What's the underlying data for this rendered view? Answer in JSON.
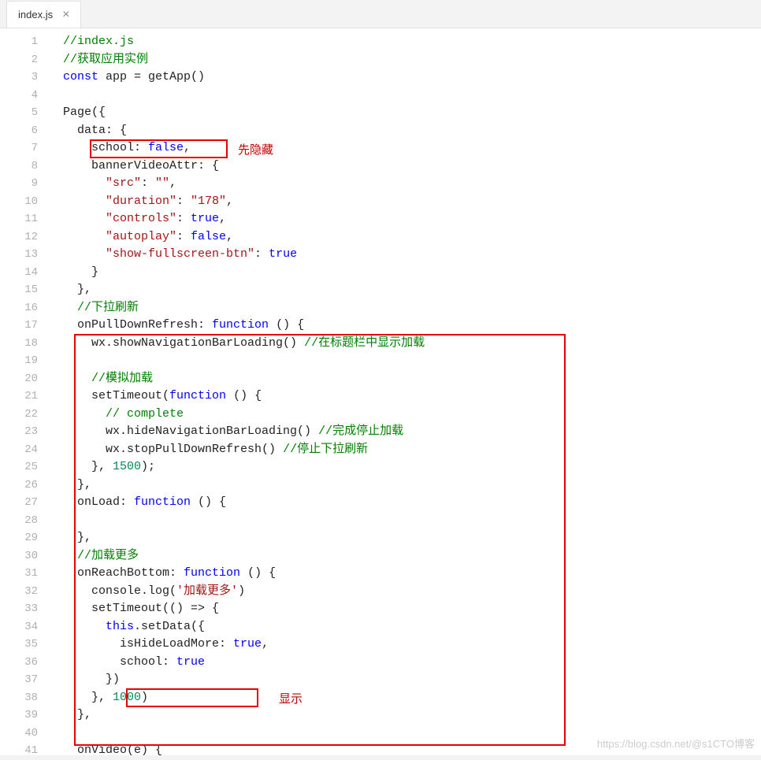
{
  "tab": {
    "filename": "index.js"
  },
  "annotations": {
    "hide": "先隐藏",
    "show": "显示"
  },
  "watermark": "https://blog.csdn.net/@s1CTO博客",
  "code": {
    "l1": {
      "i": "",
      "t": [
        [
          "c",
          "//index.js"
        ]
      ]
    },
    "l2": {
      "i": "",
      "t": [
        [
          "c",
          "//获取应用实例"
        ]
      ]
    },
    "l3": {
      "i": "",
      "t": [
        [
          "k",
          "const"
        ],
        [
          "p",
          " app = getApp()"
        ]
      ]
    },
    "l4": {
      "i": "",
      "t": []
    },
    "l5": {
      "i": "",
      "t": [
        [
          "p",
          "Page({"
        ]
      ]
    },
    "l6": {
      "i": "  ",
      "t": [
        [
          "p",
          "data: {"
        ]
      ]
    },
    "l7": {
      "i": "    ",
      "t": [
        [
          "p",
          "school: "
        ],
        [
          "k",
          "false"
        ],
        [
          "p",
          ","
        ]
      ]
    },
    "l8": {
      "i": "    ",
      "t": [
        [
          "p",
          "bannerVideoAttr: {"
        ]
      ]
    },
    "l9": {
      "i": "      ",
      "t": [
        [
          "s",
          "\"src\""
        ],
        [
          "p",
          ": "
        ],
        [
          "s",
          "\"\""
        ],
        [
          "p",
          ","
        ]
      ]
    },
    "l10": {
      "i": "      ",
      "t": [
        [
          "s",
          "\"duration\""
        ],
        [
          "p",
          ": "
        ],
        [
          "s",
          "\"178\""
        ],
        [
          "p",
          ","
        ]
      ]
    },
    "l11": {
      "i": "      ",
      "t": [
        [
          "s",
          "\"controls\""
        ],
        [
          "p",
          ": "
        ],
        [
          "k",
          "true"
        ],
        [
          "p",
          ","
        ]
      ]
    },
    "l12": {
      "i": "      ",
      "t": [
        [
          "s",
          "\"autoplay\""
        ],
        [
          "p",
          ": "
        ],
        [
          "k",
          "false"
        ],
        [
          "p",
          ","
        ]
      ]
    },
    "l13": {
      "i": "      ",
      "t": [
        [
          "s",
          "\"show-fullscreen-btn\""
        ],
        [
          "p",
          ": "
        ],
        [
          "k",
          "true"
        ]
      ]
    },
    "l14": {
      "i": "    ",
      "t": [
        [
          "p",
          "}"
        ]
      ]
    },
    "l15": {
      "i": "  ",
      "t": [
        [
          "p",
          "},"
        ]
      ]
    },
    "l16": {
      "i": "  ",
      "t": [
        [
          "c",
          "//下拉刷新"
        ]
      ]
    },
    "l17": {
      "i": "  ",
      "t": [
        [
          "p",
          "onPullDownRefresh: "
        ],
        [
          "k",
          "function"
        ],
        [
          "p",
          " () {"
        ]
      ]
    },
    "l18": {
      "i": "    ",
      "t": [
        [
          "p",
          "wx.showNavigationBarLoading() "
        ],
        [
          "c",
          "//在标题栏中显示加载"
        ]
      ]
    },
    "l19": {
      "i": "",
      "t": []
    },
    "l20": {
      "i": "    ",
      "t": [
        [
          "c",
          "//模拟加载"
        ]
      ]
    },
    "l21": {
      "i": "    ",
      "t": [
        [
          "p",
          "setTimeout("
        ],
        [
          "k",
          "function"
        ],
        [
          "p",
          " () {"
        ]
      ]
    },
    "l22": {
      "i": "      ",
      "t": [
        [
          "c",
          "// complete"
        ]
      ]
    },
    "l23": {
      "i": "      ",
      "t": [
        [
          "p",
          "wx.hideNavigationBarLoading() "
        ],
        [
          "c",
          "//完成停止加载"
        ]
      ]
    },
    "l24": {
      "i": "      ",
      "t": [
        [
          "p",
          "wx.stopPullDownRefresh() "
        ],
        [
          "c",
          "//停止下拉刷新"
        ]
      ]
    },
    "l25": {
      "i": "    ",
      "t": [
        [
          "p",
          "}, "
        ],
        [
          "n",
          "1500"
        ],
        [
          "p",
          ");"
        ]
      ]
    },
    "l26": {
      "i": "  ",
      "t": [
        [
          "p",
          "},"
        ]
      ]
    },
    "l27": {
      "i": "  ",
      "t": [
        [
          "p",
          "onLoad: "
        ],
        [
          "k",
          "function"
        ],
        [
          "p",
          " () {"
        ]
      ]
    },
    "l28": {
      "i": "",
      "t": []
    },
    "l29": {
      "i": "  ",
      "t": [
        [
          "p",
          "},"
        ]
      ]
    },
    "l30": {
      "i": "  ",
      "t": [
        [
          "c",
          "//加载更多"
        ]
      ]
    },
    "l31": {
      "i": "  ",
      "t": [
        [
          "p",
          "onReachBottom: "
        ],
        [
          "k",
          "function"
        ],
        [
          "p",
          " () {"
        ]
      ]
    },
    "l32": {
      "i": "    ",
      "t": [
        [
          "p",
          "console.log("
        ],
        [
          "s",
          "'加载更多'"
        ],
        [
          "p",
          ")"
        ]
      ]
    },
    "l33": {
      "i": "    ",
      "t": [
        [
          "p",
          "setTimeout(() => {"
        ]
      ]
    },
    "l34": {
      "i": "      ",
      "t": [
        [
          "k",
          "this"
        ],
        [
          "p",
          ".setData({"
        ]
      ]
    },
    "l35": {
      "i": "        ",
      "t": [
        [
          "p",
          "isHideLoadMore: "
        ],
        [
          "k",
          "true"
        ],
        [
          "p",
          ","
        ]
      ]
    },
    "l36": {
      "i": "        ",
      "t": [
        [
          "p",
          "school: "
        ],
        [
          "k",
          "true"
        ]
      ]
    },
    "l37": {
      "i": "      ",
      "t": [
        [
          "p",
          "})"
        ]
      ]
    },
    "l38": {
      "i": "    ",
      "t": [
        [
          "p",
          "}, "
        ],
        [
          "n",
          "1000"
        ],
        [
          "p",
          ")"
        ]
      ]
    },
    "l39": {
      "i": "  ",
      "t": [
        [
          "p",
          "},"
        ]
      ]
    },
    "l40": {
      "i": "",
      "t": []
    },
    "l41": {
      "i": "  ",
      "t": [
        [
          "p",
          "onVideo(e) {"
        ]
      ]
    }
  }
}
